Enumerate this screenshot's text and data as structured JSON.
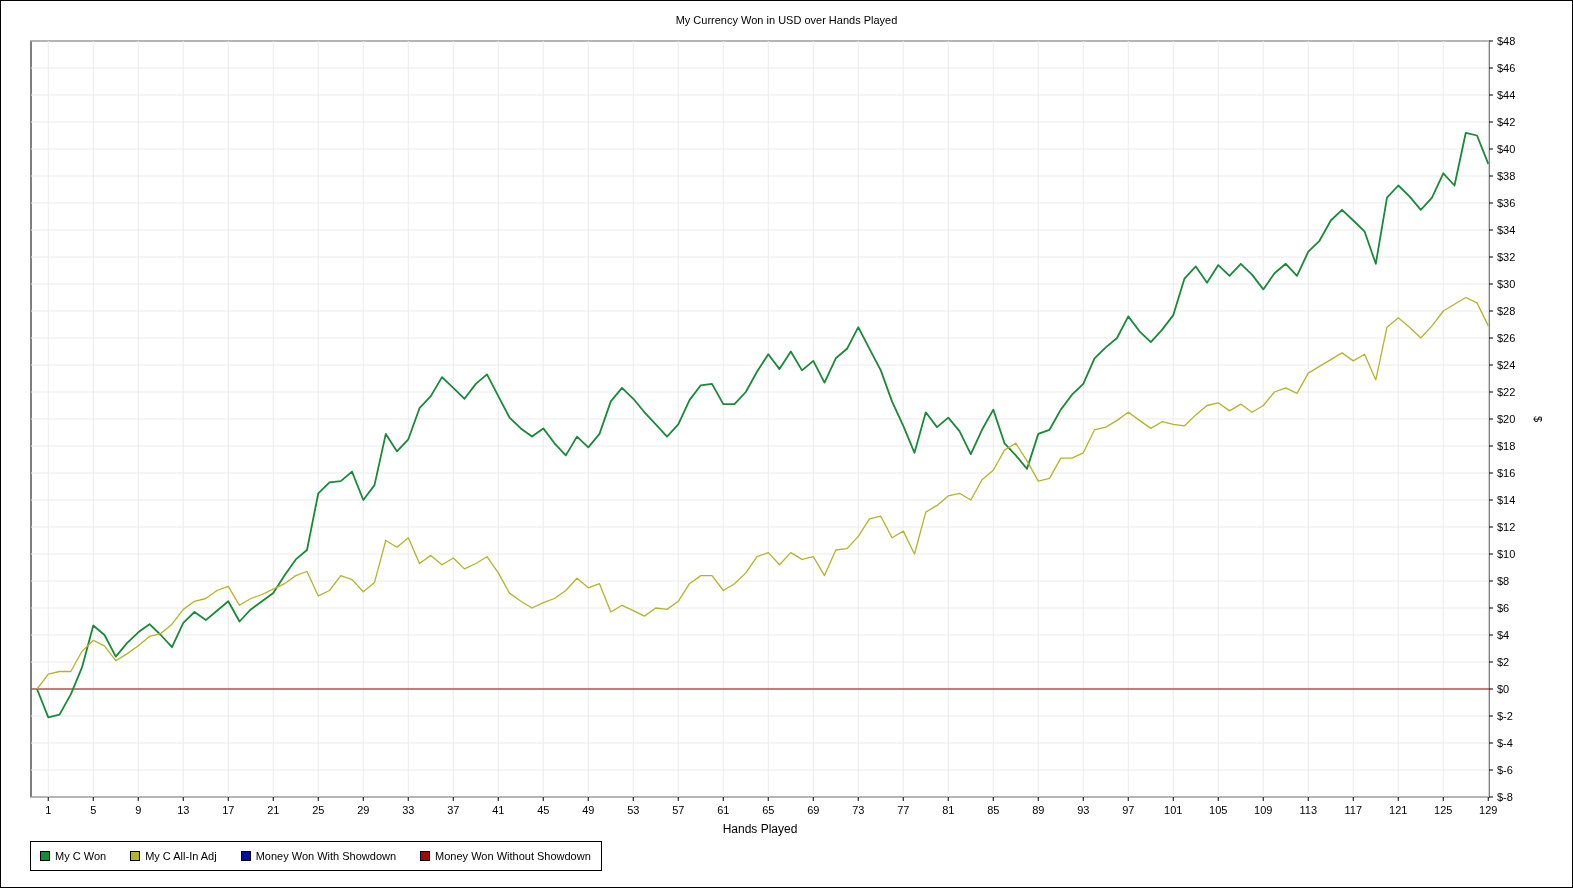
{
  "chart": {
    "chart_data": {
      "type": "line",
      "title": "My Currency Won in USD over Hands Played",
      "xlabel": "Hands Played",
      "ylabel": "$",
      "xlim": [
        0,
        129
      ],
      "ylim": [
        -8,
        48
      ],
      "grid": true,
      "x": [
        0,
        1,
        2,
        3,
        4,
        5,
        6,
        7,
        8,
        9,
        10,
        11,
        12,
        13,
        14,
        15,
        16,
        17,
        18,
        19,
        20,
        21,
        22,
        23,
        24,
        25,
        26,
        27,
        28,
        29,
        30,
        31,
        32,
        33,
        34,
        35,
        36,
        37,
        38,
        39,
        40,
        41,
        42,
        43,
        44,
        45,
        46,
        47,
        48,
        49,
        50,
        51,
        52,
        53,
        54,
        55,
        56,
        57,
        58,
        59,
        60,
        61,
        62,
        63,
        64,
        65,
        66,
        67,
        68,
        69,
        70,
        71,
        72,
        73,
        74,
        75,
        76,
        77,
        78,
        79,
        80,
        81,
        82,
        83,
        84,
        85,
        86,
        87,
        88,
        89,
        90,
        91,
        92,
        93,
        94,
        95,
        96,
        97,
        98,
        99,
        100,
        101,
        102,
        103,
        104,
        105,
        106,
        107,
        108,
        109,
        110,
        111,
        112,
        113,
        114,
        115,
        116,
        117,
        118,
        119,
        120,
        121,
        122,
        123,
        124,
        125,
        126,
        127,
        128,
        129
      ],
      "xticks": [
        1,
        5,
        9,
        13,
        17,
        21,
        25,
        29,
        33,
        37,
        41,
        45,
        49,
        53,
        57,
        61,
        65,
        69,
        73,
        77,
        81,
        85,
        89,
        93,
        97,
        101,
        105,
        109,
        113,
        117,
        121,
        125,
        129
      ],
      "yticks": [
        {
          "value": -8,
          "label": "$-8"
        },
        {
          "value": -6,
          "label": "$-6"
        },
        {
          "value": -4,
          "label": "$-4"
        },
        {
          "value": -2,
          "label": "$-2"
        },
        {
          "value": 0,
          "label": "$0"
        },
        {
          "value": 2,
          "label": "$2"
        },
        {
          "value": 4,
          "label": "$4"
        },
        {
          "value": 6,
          "label": "$6"
        },
        {
          "value": 8,
          "label": "$8"
        },
        {
          "value": 10,
          "label": "$10"
        },
        {
          "value": 12,
          "label": "$12"
        },
        {
          "value": 14,
          "label": "$14"
        },
        {
          "value": 16,
          "label": "$16"
        },
        {
          "value": 18,
          "label": "$18"
        },
        {
          "value": 20,
          "label": "$20"
        },
        {
          "value": 22,
          "label": "$22"
        },
        {
          "value": 24,
          "label": "$24"
        },
        {
          "value": 26,
          "label": "$26"
        },
        {
          "value": 28,
          "label": "$28"
        },
        {
          "value": 30,
          "label": "$30"
        },
        {
          "value": 32,
          "label": "$32"
        },
        {
          "value": 34,
          "label": "$34"
        },
        {
          "value": 36,
          "label": "$36"
        },
        {
          "value": 38,
          "label": "$38"
        },
        {
          "value": 40,
          "label": "$40"
        },
        {
          "value": 42,
          "label": "$42"
        },
        {
          "value": 44,
          "label": "$44"
        },
        {
          "value": 46,
          "label": "$46"
        },
        {
          "value": 48,
          "label": "$48"
        }
      ],
      "series": [
        {
          "name": "My C Won",
          "color": "#188a38",
          "values": [
            0,
            -2.1,
            -1.9,
            -0.4,
            1.6,
            4.7,
            4.0,
            2.4,
            3.4,
            4.2,
            4.8,
            4.0,
            3.1,
            4.9,
            5.7,
            5.1,
            5.8,
            6.5,
            5.0,
            5.9,
            6.5,
            7.1,
            8.4,
            9.6,
            10.3,
            14.5,
            15.3,
            15.4,
            16.1,
            14.0,
            15.1,
            18.9,
            17.6,
            18.5,
            20.8,
            21.7,
            23.1,
            22.3,
            21.5,
            22.6,
            23.3,
            21.7,
            20.1,
            19.3,
            18.7,
            19.3,
            18.2,
            17.3,
            18.7,
            17.9,
            18.9,
            21.3,
            22.3,
            21.5,
            20.5,
            19.6,
            18.7,
            19.6,
            21.4,
            22.5,
            22.6,
            21.1,
            21.1,
            22.0,
            23.5,
            24.8,
            23.7,
            25.0,
            23.6,
            24.3,
            22.7,
            24.5,
            25.2,
            26.8,
            25.2,
            23.6,
            21.3,
            19.5,
            17.5,
            20.5,
            19.4,
            20.1,
            19.1,
            17.4,
            19.2,
            20.7,
            18.2,
            17.3,
            16.3,
            18.9,
            19.2,
            20.7,
            21.8,
            22.6,
            24.5,
            25.3,
            26.0,
            27.6,
            26.5,
            25.7,
            26.6,
            27.7,
            30.4,
            31.3,
            30.1,
            31.4,
            30.6,
            31.5,
            30.7,
            29.6,
            30.8,
            31.5,
            30.6,
            32.4,
            33.2,
            34.7,
            35.5,
            34.7,
            33.9,
            31.5,
            36.4,
            37.3,
            36.5,
            35.5,
            36.4,
            38.2,
            37.3,
            41.2,
            41.0,
            38.9
          ]
        },
        {
          "name": "My C All-In Adj",
          "color": "#b4b42a",
          "values": [
            0,
            1.1,
            1.3,
            1.3,
            2.8,
            3.6,
            3.2,
            2.1,
            2.6,
            3.2,
            3.9,
            4.1,
            4.8,
            5.9,
            6.5,
            6.7,
            7.3,
            7.6,
            6.2,
            6.7,
            7.0,
            7.4,
            7.8,
            8.4,
            8.7,
            6.9,
            7.3,
            8.4,
            8.1,
            7.2,
            7.9,
            11.0,
            10.5,
            11.2,
            9.3,
            9.9,
            9.2,
            9.7,
            8.9,
            9.3,
            9.8,
            8.6,
            7.1,
            6.5,
            6.0,
            6.4,
            6.7,
            7.3,
            8.2,
            7.5,
            7.8,
            5.7,
            6.2,
            5.8,
            5.4,
            6.0,
            5.9,
            6.5,
            7.8,
            8.4,
            8.4,
            7.3,
            7.8,
            8.6,
            9.8,
            10.1,
            9.2,
            10.1,
            9.6,
            9.8,
            8.4,
            10.3,
            10.4,
            11.3,
            12.6,
            12.8,
            11.2,
            11.7,
            10.0,
            13.1,
            13.6,
            14.3,
            14.5,
            14.0,
            15.5,
            16.2,
            17.7,
            18.2,
            16.9,
            15.4,
            15.6,
            17.1,
            17.1,
            17.5,
            19.2,
            19.4,
            19.9,
            20.5,
            19.9,
            19.3,
            19.8,
            19.6,
            19.5,
            20.3,
            21.0,
            21.2,
            20.6,
            21.1,
            20.5,
            21.0,
            22.0,
            22.3,
            21.9,
            23.4,
            23.9,
            24.4,
            24.9,
            24.3,
            24.8,
            22.9,
            26.8,
            27.5,
            26.8,
            26.0,
            26.9,
            28.0,
            28.5,
            29.0,
            28.6,
            26.9
          ]
        }
      ],
      "ref_lines": [
        {
          "axis": "y",
          "value": 0,
          "color": "#a00000"
        }
      ]
    },
    "legend_extra": [
      {
        "name": "Money Won With Showdown",
        "color": "#0010a0"
      },
      {
        "name": "Money Won Without Showdown",
        "color": "#a00808"
      }
    ]
  }
}
